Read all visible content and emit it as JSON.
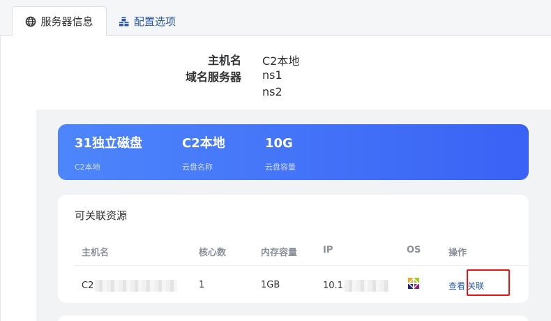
{
  "tabs": [
    {
      "label": "服务器信息",
      "icon": "globe-icon",
      "active": true
    },
    {
      "label": "配置选项",
      "icon": "cubes-icon",
      "active": false
    }
  ],
  "server_info": {
    "hostname_label": "主机名",
    "hostname_value": "C2本地",
    "dns_label": "域名服务器",
    "dns_values": [
      "ns1",
      "ns2"
    ]
  },
  "banner": {
    "stats": [
      {
        "value": "31独立磁盘",
        "label": "C2本地"
      },
      {
        "value": "C2本地",
        "label": "云盘名称"
      },
      {
        "value": "10G",
        "label": "云盘容量"
      }
    ]
  },
  "resources": {
    "title": "可关联资源",
    "columns": [
      "主机名",
      "核心数",
      "内存容量",
      "IP",
      "OS",
      "操作"
    ],
    "rows": [
      {
        "hostname": "C2",
        "cores": "1",
        "memory": "1GB",
        "ip": "10.1",
        "os_icon": "centos-icon",
        "actions": [
          "查看",
          "关联"
        ]
      }
    ]
  },
  "colors": {
    "accent": "#2b5aa8",
    "banner_start": "#4d86fb",
    "banner_end": "#3a62f5",
    "highlight": "#e11111"
  }
}
